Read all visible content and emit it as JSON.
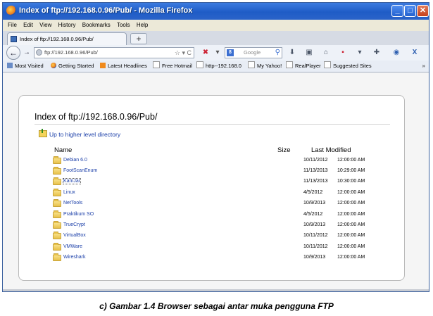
{
  "window": {
    "title": "Index of ftp://192.168.0.96/Pub/ - Mozilla Firefox"
  },
  "menu": [
    "File",
    "Edit",
    "View",
    "History",
    "Bookmarks",
    "Tools",
    "Help"
  ],
  "tab": {
    "label": "Index of ftp://192.168.0.96/Pub/",
    "new_tab": "+"
  },
  "nav": {
    "url": "ftp://192.168.0.96/Pub/",
    "search_placeholder": "Google"
  },
  "bookmarks": [
    "Most Visited",
    "Getting Started",
    "Latest Headlines",
    "Free Hotmail",
    "http--192.168.0",
    "My Yahoo!",
    "RealPlayer",
    "Suggested Sites"
  ],
  "page": {
    "heading": "Index of ftp://192.168.0.96/Pub/",
    "up_link": "Up to higher level directory",
    "col_name": "Name",
    "col_size": "Size",
    "col_modified": "Last Modified",
    "rows": [
      {
        "name": "Debian 6.0",
        "date": "10/11/2012",
        "time": "12:00:00 AM"
      },
      {
        "name": "FootScanEnum",
        "date": "11/13/2013",
        "time": "10:29:00 AM"
      },
      {
        "name": "KamJar",
        "date": "11/13/2013",
        "time": "10:30:00 AM"
      },
      {
        "name": "Linux",
        "date": "4/5/2012",
        "time": "12:00:00 AM"
      },
      {
        "name": "NetTools",
        "date": "10/9/2013",
        "time": "12:00:00 AM"
      },
      {
        "name": "Praktikum SO",
        "date": "4/5/2012",
        "time": "12:00:00 AM"
      },
      {
        "name": "TrueCrypt",
        "date": "10/9/2013",
        "time": "12:00:00 AM"
      },
      {
        "name": "VirtualBox",
        "date": "10/11/2012",
        "time": "12:00:00 AM"
      },
      {
        "name": "VMWare",
        "date": "10/11/2012",
        "time": "12:00:00 AM"
      },
      {
        "name": "Wireshark",
        "date": "10/9/2013",
        "time": "12:00:00 AM"
      }
    ]
  },
  "caption": "c)    Gambar 1.4 Browser sebagai antar muka pengguna FTP"
}
